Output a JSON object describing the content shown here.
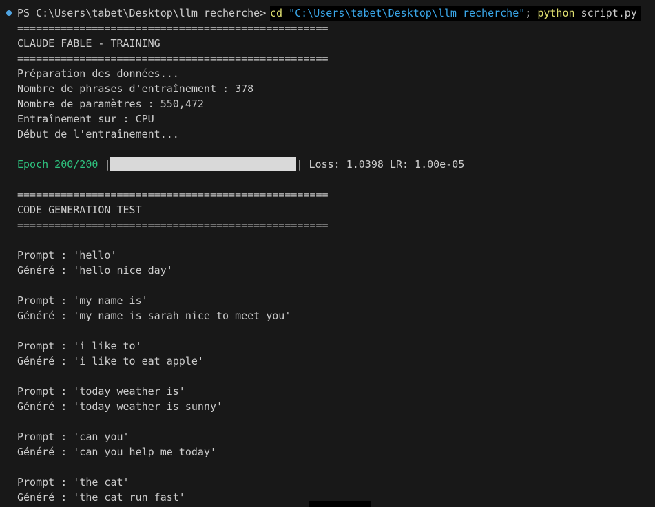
{
  "prompt": {
    "ps": "PS C:\\Users\\tabet\\Desktop\\llm recherche> ",
    "cmd_cd": "cd ",
    "cmd_path": "\"C:\\Users\\tabet\\Desktop\\llm recherche\"",
    "cmd_semi": "; ",
    "cmd_python": "python",
    "cmd_script": " script.py"
  },
  "separator": "==================================================",
  "header_title": "CLAUDE FABLE - TRAINING",
  "prep": [
    "Préparation des données...",
    "Nombre de phrases d'entraînement : 378",
    "Nombre de paramètres : 550,472",
    "Entraînement sur : CPU",
    "Début de l'entraînement..."
  ],
  "progress": {
    "epoch_label": "Epoch 200/200 ",
    "bar_open": "|",
    "bar_close": "|",
    "fraction": 1.0,
    "stats": " Loss: 1.0398 LR: 1.00e-05"
  },
  "test_title": "CODE GENERATION TEST",
  "samples": [
    {
      "prompt": "Prompt : 'hello'",
      "generated": "Généré : 'hello nice day'"
    },
    {
      "prompt": "Prompt : 'my name is'",
      "generated": "Généré : 'my name is sarah nice to meet you'"
    },
    {
      "prompt": "Prompt : 'i like to'",
      "generated": "Généré : 'i like to eat apple'"
    },
    {
      "prompt": "Prompt : 'today weather is'",
      "generated": "Généré : 'today weather is sunny'"
    },
    {
      "prompt": "Prompt : 'can you'",
      "generated": "Généré : 'can you help me today'"
    },
    {
      "prompt": "Prompt : 'the cat'",
      "generated": "Généré : 'the cat run fast'"
    }
  ],
  "colors": {
    "background": "#181818",
    "text": "#cccccc",
    "success": "#2ec27e",
    "path": "#3aa6e8",
    "command": "#dcdc6e",
    "bar_fill": "#d9d9d9",
    "status_dot": "#4fa3e0"
  }
}
